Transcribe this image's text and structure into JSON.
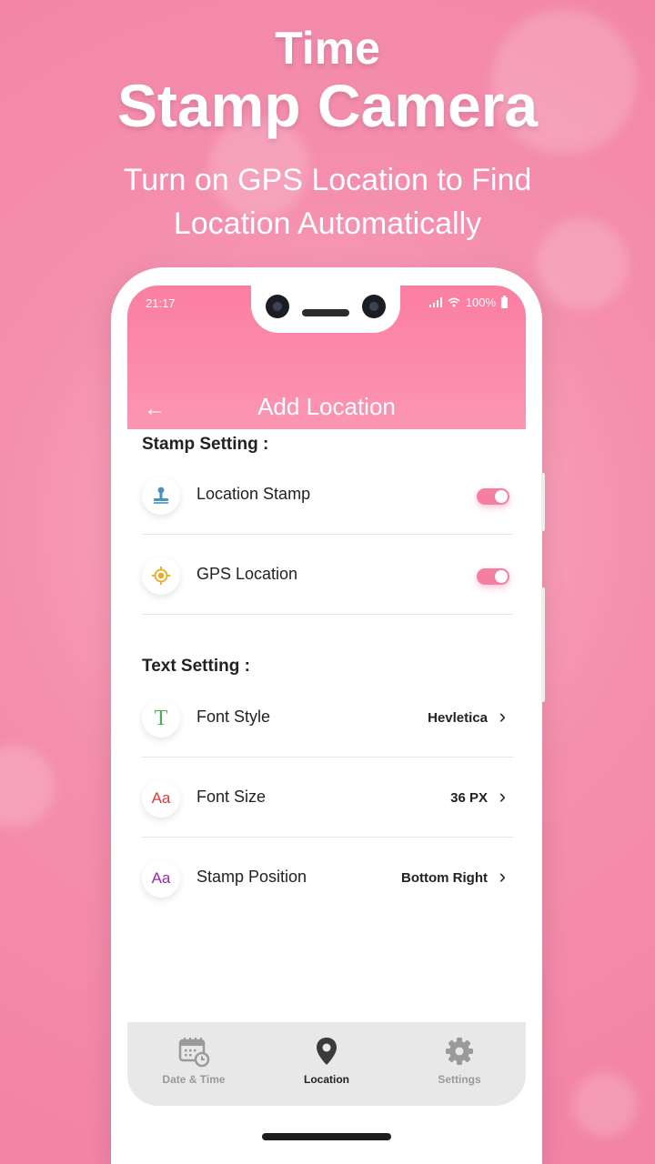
{
  "promo": {
    "title_line1": "Time",
    "title_line2": "Stamp Camera",
    "subtitle_line1": "Turn on GPS Location to Find",
    "subtitle_line2": "Location Automatically"
  },
  "status_bar": {
    "time": "21:17",
    "battery": "100%"
  },
  "header": {
    "title": "Add Location",
    "back_icon": "←"
  },
  "stamp_setting": {
    "title": "Stamp Setting :",
    "items": [
      {
        "label": "Location Stamp",
        "icon": "stamp-icon",
        "enabled": true
      },
      {
        "label": "GPS Location",
        "icon": "gps-target-icon",
        "enabled": true
      }
    ]
  },
  "text_setting": {
    "title": "Text Setting :",
    "items": [
      {
        "label": "Font Style",
        "value": "Hevletica",
        "icon": "T",
        "icon_color": "#4caf50"
      },
      {
        "label": "Font Size",
        "value": "36 PX",
        "icon": "Aa",
        "icon_color": "#e53935"
      },
      {
        "label": "Stamp Position",
        "value": "Bottom Right",
        "icon": "Aa",
        "icon_color": "#9c27b0"
      }
    ],
    "chevron": "›"
  },
  "bottom_nav": {
    "items": [
      {
        "label": "Date & Time",
        "active": false
      },
      {
        "label": "Location",
        "active": true
      },
      {
        "label": "Settings",
        "active": false
      }
    ]
  },
  "colors": {
    "accent": "#f67fa1",
    "header_top": "#fb7ea0",
    "header_bottom": "#fb96b2"
  }
}
